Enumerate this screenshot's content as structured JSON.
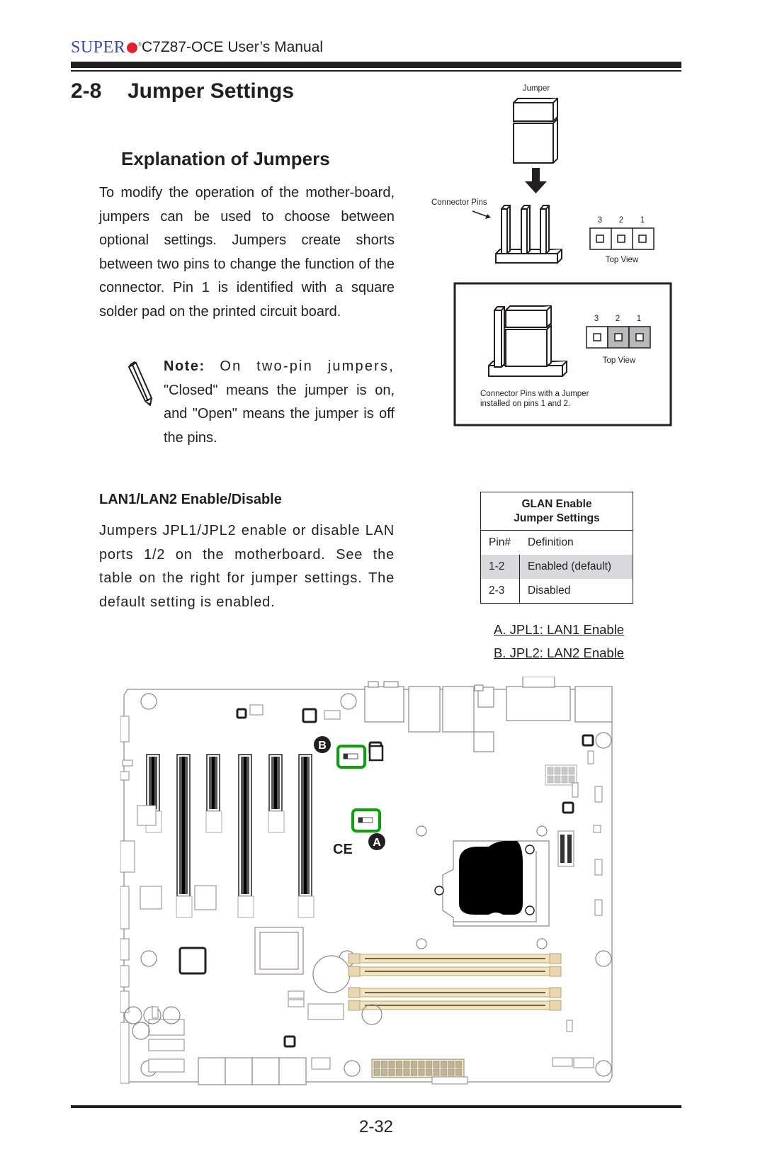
{
  "header": {
    "brand": "SUPER",
    "brand_mark": "®",
    "manual_title": "C7Z87-OCE User’s Manual"
  },
  "section": {
    "number": "2-8",
    "title": "Jumper Settings"
  },
  "explanation": {
    "title": "Explanation of Jumpers",
    "body": "To modify the operation of the mother-board, jumpers can be used to choose between optional settings. Jumpers create shorts between two pins to change the function of the connector. Pin 1 is identified with a square solder pad on the printed circuit board.",
    "note_label": "Note:",
    "note_lead": " On two-pin jumpers,",
    "note_body": "\"Closed\" means the jumper is on, and \"Open\" means the jumper is off the pins."
  },
  "diagram_top": {
    "jumper_label": "Jumper",
    "connector_pins_label": "Connector Pins",
    "pin_numbers": [
      "3",
      "2",
      "1"
    ],
    "top_view_label": "Top View"
  },
  "diagram_box": {
    "pin_numbers": [
      "3",
      "2",
      "1"
    ],
    "top_view_label": "Top View",
    "caption_line1": "Connector Pins with a Jumper",
    "caption_line2": "installed on pins 1 and 2."
  },
  "lan": {
    "title": "LAN1/LAN2 Enable/Disable",
    "body": "Jumpers JPL1/JPL2 enable or disable LAN ports 1/2 on the motherboard. See the table on the right for jumper settings. The default setting is enabled."
  },
  "jumper_table": {
    "title_line1": "GLAN Enable",
    "title_line2": "Jumper Settings",
    "columns": [
      "Pin#",
      "Definition"
    ],
    "rows": [
      {
        "pin": "1-2",
        "definition": "Enabled (default)"
      },
      {
        "pin": "2-3",
        "definition": "Disabled"
      }
    ]
  },
  "callouts": {
    "a": "A. JPL1: LAN1 Enable",
    "b": "B. JPL2: LAN2 Enable"
  },
  "board": {
    "marker_a": "A",
    "marker_b": "B",
    "highlight_color": "#0aa30a",
    "dimm_color": "#f2e4bd"
  },
  "footer": {
    "page_number": "2-32"
  }
}
